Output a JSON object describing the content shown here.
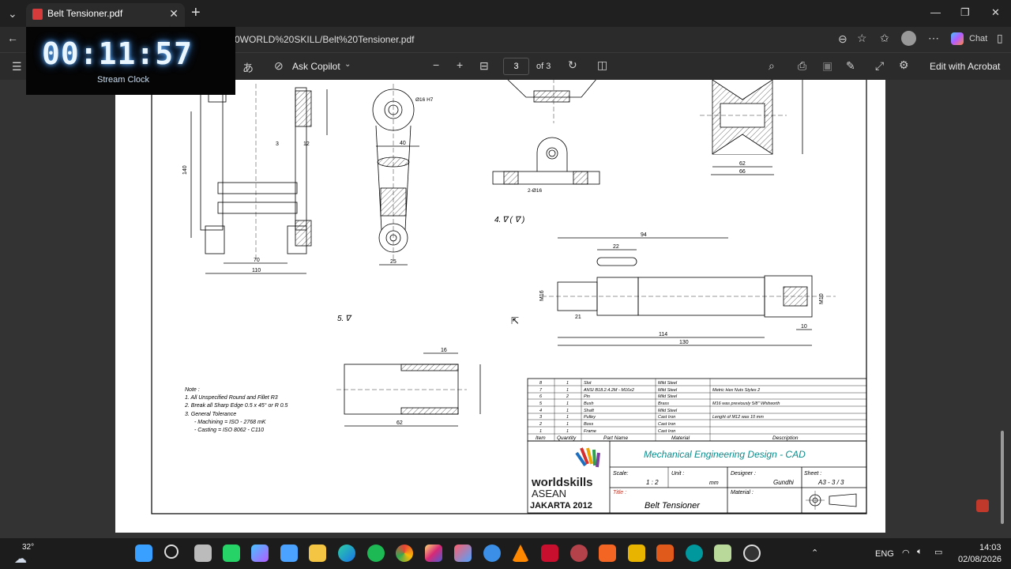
{
  "tab": {
    "title": "Belt Tensioner.pdf"
  },
  "address": {
    "url": "0WORLD%20SKILL/Belt%20Tensioner.pdf",
    "chat_label": "Chat"
  },
  "clock": {
    "time": "00:11:57",
    "label": "Stream Clock"
  },
  "pdf_toolbar": {
    "copilot_label": "Ask Copilot",
    "page_value": "3",
    "page_total": "of 3",
    "edit_label": "Edit with Acrobat"
  },
  "drawing": {
    "notes": [
      "Note :",
      "1. All Unspecified Round and Fillet R3",
      "2. Break all Sharp Edge 0.5 x 45° or R 0.5",
      "3. General Tolerance",
      "- Machining = ISO - 2768 mK",
      "- Casting = ISO 8062 - C110"
    ],
    "surface_4": "4.",
    "surface_5": "5.",
    "dims": {
      "d140": "140",
      "d70": "70",
      "d110": "110",
      "d3": "3",
      "d12": "12",
      "d40": "40",
      "d25": "25",
      "d16h7": "Ø16 H7",
      "d62": "62",
      "d66": "66",
      "d94": "94",
      "d22": "22",
      "d114": "114",
      "d130": "130",
      "d21": "21",
      "d10": "10",
      "d16": "16",
      "d62b": "62",
      "m16": "M16",
      "m10": "M10",
      "d2016": "2-Ø16"
    },
    "bom_rows": [
      {
        "item": "8",
        "qty": "1",
        "part": "Slot",
        "material": "Mild Steel",
        "desc": ""
      },
      {
        "item": "7",
        "qty": "1",
        "part": "ANSI B18.2.4.2M - M16x2",
        "material": "Mild Steel",
        "desc": "Metric Hex Nuts Styles 2"
      },
      {
        "item": "6",
        "qty": "2",
        "part": "Pin",
        "material": "Mild Steel",
        "desc": ""
      },
      {
        "item": "5",
        "qty": "1",
        "part": "Bush",
        "material": "Brass",
        "desc": "M16 was previously 5/8\" Whitworth"
      },
      {
        "item": "4",
        "qty": "1",
        "part": "Shaft",
        "material": "Mild Steel",
        "desc": ""
      },
      {
        "item": "3",
        "qty": "1",
        "part": "Pulley",
        "material": "Cast Iron",
        "desc": "Lenght of M12 was 10 mm"
      },
      {
        "item": "2",
        "qty": "1",
        "part": "Boss",
        "material": "Cast Iron",
        "desc": ""
      },
      {
        "item": "1",
        "qty": "1",
        "part": "Frame",
        "material": "Cast Iron",
        "desc": ""
      }
    ],
    "bom_header": {
      "item": "Item",
      "qty": "Quantity",
      "part": "Part Name",
      "material": "Material",
      "desc": "Description"
    },
    "title_block": {
      "heading": "Mechanical Engineering Design - CAD",
      "logo_line1": "worldskills",
      "logo_line2": "ASEAN",
      "logo_line3": "JAKARTA 2012",
      "scale_label": "Scale:",
      "scale_value": "1 : 2",
      "unit_label": "Unit :",
      "unit_value": "mm",
      "designer_label": "Designer :",
      "designer_value": "Gundhi",
      "sheet_label": "Sheet :",
      "sheet_value": "A3 - 3 / 3",
      "title_label": "Title :",
      "title_value": "Belt Tensioner",
      "material_label": "Material :"
    }
  },
  "taskbar": {
    "temp": "32°",
    "lang": "ENG",
    "time": "14:03",
    "date": "02/08/2026"
  },
  "colors": {
    "accent": "#0b8c8c",
    "title_red": "#c0392b"
  }
}
